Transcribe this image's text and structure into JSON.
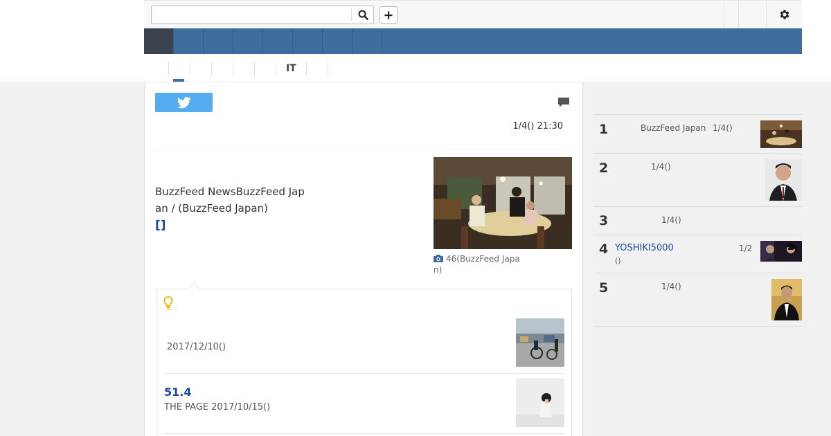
{
  "header": {
    "search_placeholder": "",
    "search_icon": "search-icon",
    "add_icon": "plus-icon",
    "settings_icon": "gear-icon",
    "plus_label": "+"
  },
  "nav": {
    "items": [
      "",
      "",
      "",
      "",
      "",
      "",
      "",
      "",
      ""
    ]
  },
  "subtabs": {
    "items": [
      "",
      "",
      "",
      "",
      "",
      "IT",
      ""
    ]
  },
  "article": {
    "tweet_icon": "twitter-icon",
    "comment_icon": "comment-icon",
    "date": "1/4() 21:30",
    "lead": "BuzzFeed NewsBuzzFeed Japan / (BuzzFeed Japan)",
    "lead_link": "[]",
    "photo_caption": "46(BuzzFeed Japan)",
    "camera_icon": "camera-icon"
  },
  "related": {
    "bulb_icon": "lightbulb-icon",
    "items": [
      {
        "title": "",
        "meta": "2017/12/10()"
      },
      {
        "title": "51.4",
        "meta": "THE PAGE 2017/10/15()"
      }
    ]
  },
  "ranking": {
    "items": [
      {
        "rank": "1",
        "text": "BuzzFeed Japan",
        "date": "1/4()"
      },
      {
        "rank": "2",
        "text": "",
        "date": "1/4()"
      },
      {
        "rank": "3",
        "text": "",
        "date": "1/4()"
      },
      {
        "rank": "4",
        "text": "YOSHIKI5000",
        "date": "1/2",
        "sub": "()"
      },
      {
        "rank": "5",
        "text": "",
        "date": "1/4()"
      }
    ]
  },
  "colors": {
    "nav_blue": "#3e6e9b",
    "nav_active": "#3b4350",
    "twitter": "#55acee",
    "link_blue": "#1a4aa0"
  }
}
